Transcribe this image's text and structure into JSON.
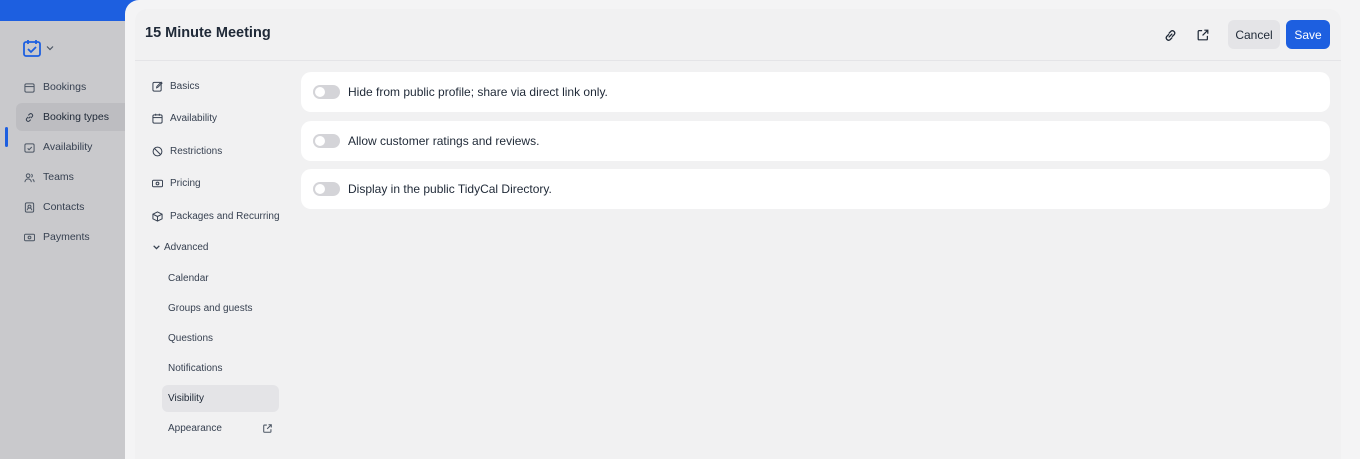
{
  "app": {
    "nav": [
      {
        "label": "Bookings",
        "icon": "calendar-icon"
      },
      {
        "label": "Booking types",
        "icon": "link-icon"
      },
      {
        "label": "Availability",
        "icon": "calendar-check-icon"
      },
      {
        "label": "Teams",
        "icon": "users-icon"
      },
      {
        "label": "Contacts",
        "icon": "contacts-icon"
      },
      {
        "label": "Payments",
        "icon": "money-icon"
      }
    ],
    "active_index": 1,
    "accent": "#1d5fe0"
  },
  "modal": {
    "title": "15 Minute Meeting",
    "cancel_label": "Cancel",
    "save_label": "Save"
  },
  "settings_nav": {
    "items": [
      {
        "label": "Basics",
        "icon": "edit-icon"
      },
      {
        "label": "Availability",
        "icon": "calendar-icon"
      },
      {
        "label": "Restrictions",
        "icon": "ban-icon"
      },
      {
        "label": "Pricing",
        "icon": "money-icon"
      },
      {
        "label": "Packages and Recurring",
        "icon": "package-icon"
      }
    ],
    "advanced_label": "Advanced",
    "advanced_items": [
      {
        "label": "Calendar"
      },
      {
        "label": "Groups and guests"
      },
      {
        "label": "Questions"
      },
      {
        "label": "Notifications"
      },
      {
        "label": "Visibility"
      },
      {
        "label": "Appearance"
      }
    ],
    "active_advanced_index": 4
  },
  "visibility": {
    "options": [
      {
        "label": "Hide from public profile; share via direct link only.",
        "enabled": false
      },
      {
        "label": "Allow customer ratings and reviews.",
        "enabled": false
      },
      {
        "label": "Display in the public TidyCal Directory.",
        "enabled": false
      }
    ]
  }
}
